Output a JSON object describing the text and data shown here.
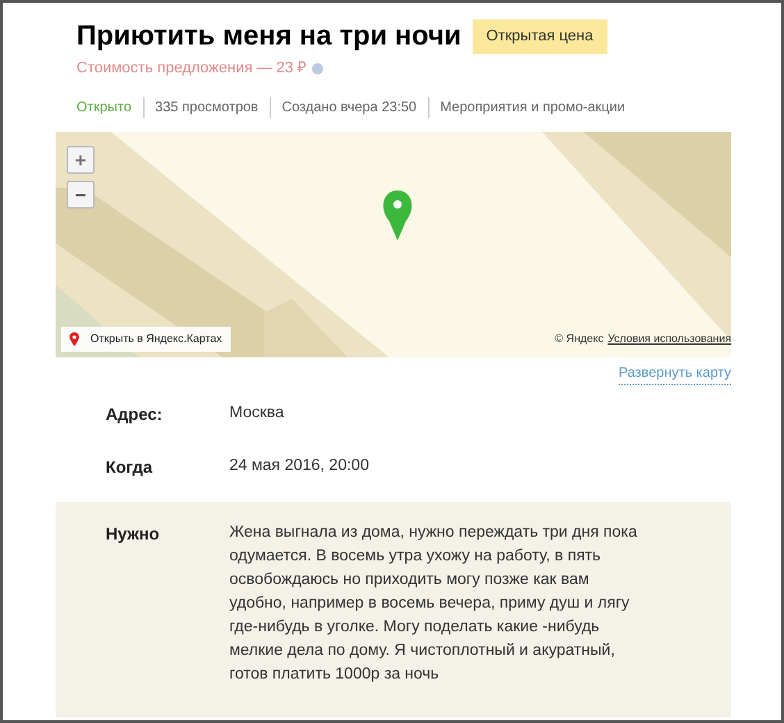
{
  "title": "Приютить меня на три ночи",
  "badge": "Открытая цена",
  "offer_cost": "Стоимость предложения — 23 ₽",
  "meta": [
    {
      "text": "Открыто",
      "kind": "status"
    },
    {
      "text": "335 просмотров",
      "kind": "plain"
    },
    {
      "text": "Создано вчера 23:50",
      "kind": "plain"
    },
    {
      "text": "Мероприятия и промо-акции",
      "kind": "plain"
    }
  ],
  "map": {
    "zoom_in": "+",
    "zoom_out": "−",
    "open_link": "Открыть в Яндекс.Картах",
    "copyright": "© Яндекс",
    "terms_link": "Условия использования",
    "expand_link": "Развернуть карту"
  },
  "details": [
    {
      "label": "Адрес:",
      "value": "Москва",
      "shaded": false
    },
    {
      "label": "Когда",
      "value": "24 мая 2016, 20:00",
      "shaded": false
    },
    {
      "label": "Нужно",
      "value": "Жена выгнала из дома, нужно переждать три дня пока одумается. В восемь утра ухожу на работу, в  пять освобождаюсь но приходить могу позже как вам удобно, например в восемь вечера, приму душ и лягу где-нибудь в уголке. Могу поделать какие -нибудь мелкие дела по дому. Я чистоплотный и акуратный, готов платить 1000р за ночь",
      "shaded": true
    }
  ]
}
